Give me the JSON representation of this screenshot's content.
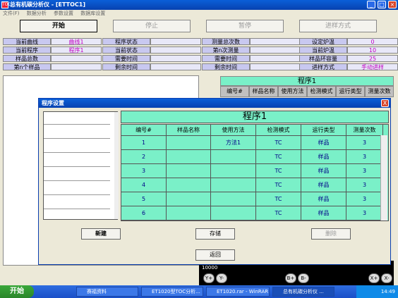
{
  "window": {
    "title": "总有机碳分析仪 - [ETTOC1]",
    "icon_text": "TOC"
  },
  "menubar": [
    "文件(F)",
    "数据分析",
    "参数设置",
    "数据库设置"
  ],
  "toolbar": {
    "start": "开始",
    "stop": "停止",
    "pause": "暂停",
    "mode": "进样方式"
  },
  "info": {
    "col1": [
      {
        "k": "当前曲线",
        "v": "曲线1"
      },
      {
        "k": "当前程序",
        "v": "程序1"
      },
      {
        "k": "样品总数",
        "v": ""
      },
      {
        "k": "第n个样品",
        "v": ""
      }
    ],
    "col2": [
      {
        "k": "程序状态",
        "v": ""
      },
      {
        "k": "当前状态",
        "v": ""
      },
      {
        "k": "需要时间",
        "v": ""
      },
      {
        "k": "剩余时间",
        "v": ""
      }
    ],
    "col3": [
      {
        "k": "测量总次数",
        "v": ""
      },
      {
        "k": "第n次测量",
        "v": ""
      },
      {
        "k": "需要时间",
        "v": ""
      },
      {
        "k": "剩余时间",
        "v": ""
      }
    ],
    "col4": [
      {
        "k": "设定炉温",
        "v": "0"
      },
      {
        "k": "当前炉温",
        "v": "10"
      },
      {
        "k": "样品环容量",
        "v": "25"
      },
      {
        "k": "进样方式",
        "v": "手动进样"
      }
    ]
  },
  "right_table": {
    "title": "程序1",
    "headers": [
      "编号#",
      "样品名称",
      "使用方法",
      "检测模式",
      "运行类型",
      "测量次数"
    ]
  },
  "right_bottom": {
    "scale": "10000",
    "buttons": [
      "Y+",
      "Y-",
      "B+",
      "B-",
      "X+",
      "X-"
    ]
  },
  "dialog": {
    "title": "程序设置",
    "close": "X",
    "table_title": "程序1",
    "headers": [
      "编号#",
      "样品名称",
      "使用方法",
      "检测模式",
      "运行类型",
      "测量次数"
    ],
    "rows": [
      [
        "1",
        "",
        "方法1",
        "TC",
        "样品",
        "3"
      ],
      [
        "2",
        "",
        "",
        "TC",
        "样品",
        "3"
      ],
      [
        "3",
        "",
        "",
        "TC",
        "样品",
        "3"
      ],
      [
        "4",
        "",
        "",
        "TC",
        "样品",
        "3"
      ],
      [
        "5",
        "",
        "",
        "TC",
        "样品",
        "3"
      ],
      [
        "6",
        "",
        "",
        "TC",
        "样品",
        "3"
      ]
    ],
    "buttons": {
      "new": "新建",
      "save": "存储",
      "delete": "删除",
      "back": "返回"
    }
  },
  "taskbar": {
    "start": "开始",
    "items": [
      "赛福资料",
      "ET1020型TOC分析...",
      "ET1020.rar - WinRAR",
      "总有机碳分析仪 ..."
    ],
    "clock": "14:49"
  }
}
